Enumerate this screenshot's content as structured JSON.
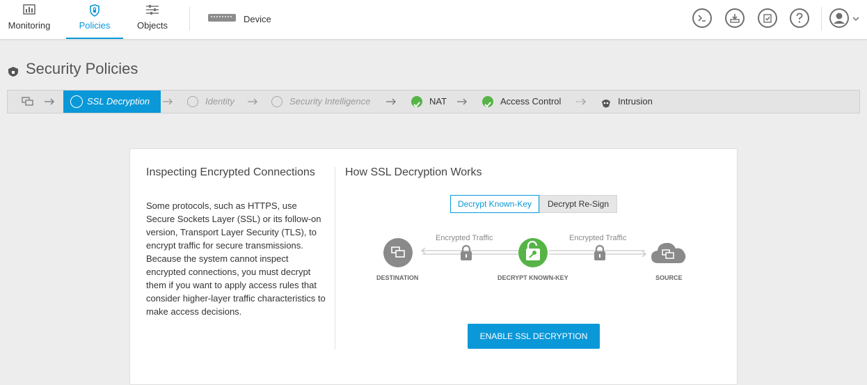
{
  "nav": {
    "monitoring": "Monitoring",
    "policies": "Policies",
    "objects": "Objects",
    "device": "Device"
  },
  "page": {
    "title": "Security Policies"
  },
  "steps": {
    "ssl": "SSL Decryption",
    "identity": "Identity",
    "security_intelligence": "Security Intelligence",
    "nat": "NAT",
    "access_control": "Access Control",
    "intrusion": "Intrusion"
  },
  "card": {
    "left_title": "Inspecting Encrypted Connections",
    "left_body": "Some protocols, such as HTTPS, use Secure Sockets Layer (SSL) or its follow-on version, Transport Layer Security (TLS), to encrypt traffic for secure transmissions. Because the system cannot inspect encrypted connections, you must decrypt them if you want to apply access rules that consider higher-layer traffic characteristics to make access decisions.",
    "right_title": "How SSL Decryption Works",
    "toggle_known_key": "Decrypt Known-Key",
    "toggle_resign": "Decrypt Re-Sign",
    "traffic_left": "Encrypted Traffic",
    "traffic_right": "Encrypted Traffic",
    "destination": "DESTINATION",
    "decrypt_known_key": "DECRYPT KNOWN-KEY",
    "source": "SOURCE",
    "enable_button": "ENABLE SSL DECRYPTION"
  },
  "colors": {
    "accent": "#0a98d8",
    "success": "#56b447",
    "node_gray": "#8a8a8a"
  }
}
